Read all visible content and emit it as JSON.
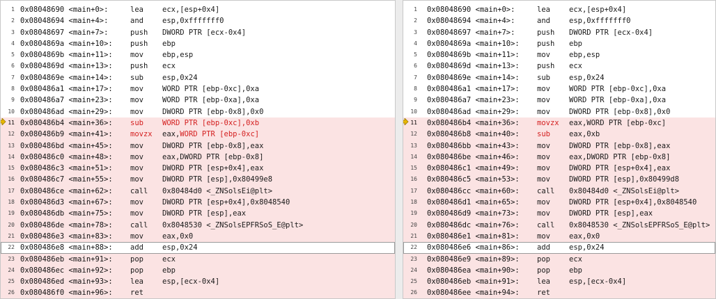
{
  "left_pane": {
    "rows": [
      {
        "n": "1",
        "addr": "0x08048690 <main+0>:",
        "op": "lea",
        "args": "ecx,[esp+0x4]",
        "changed": false
      },
      {
        "n": "2",
        "addr": "0x08048694 <main+4>:",
        "op": "and",
        "args": "esp,0xfffffff0",
        "changed": false
      },
      {
        "n": "3",
        "addr": "0x08048697 <main+7>:",
        "op": "push",
        "args": "DWORD PTR [ecx-0x4]",
        "changed": false
      },
      {
        "n": "4",
        "addr": "0x0804869a <main+10>:",
        "op": "push",
        "args": "ebp",
        "changed": false
      },
      {
        "n": "5",
        "addr": "0x0804869b <main+11>:",
        "op": "mov",
        "args": "ebp,esp",
        "changed": false
      },
      {
        "n": "6",
        "addr": "0x0804869d <main+13>:",
        "op": "push",
        "args": "ecx",
        "changed": false
      },
      {
        "n": "7",
        "addr": "0x0804869e <main+14>:",
        "op": "sub",
        "args": "esp,0x24",
        "changed": false
      },
      {
        "n": "8",
        "addr": "0x080486a1 <main+17>:",
        "op": "mov",
        "args": "WORD PTR [ebp-0xc],0xa",
        "changed": false
      },
      {
        "n": "9",
        "addr": "0x080486a7 <main+23>:",
        "op": "mov",
        "args": "WORD PTR [ebp-0xa],0xa",
        "changed": false
      },
      {
        "n": "10",
        "addr": "0x080486ad <main+29>:",
        "op": "mov",
        "args": "DWORD PTR [ebp-0x8],0x0",
        "changed": false
      },
      {
        "n": "11",
        "addr": "0x080486b4 <main+36>:",
        "op": "sub",
        "args": "WORD PTR [ebp-0xc],0xb",
        "changed": true,
        "pointer": true,
        "op_red": true,
        "args_red": true
      },
      {
        "n": "12",
        "addr": "0x080486b9 <main+41>:",
        "op": "movzx",
        "args_plain": "eax,",
        "args": "WORD PTR [ebp-0xc]",
        "changed": true,
        "op_red": true,
        "args_red": true
      },
      {
        "n": "13",
        "addr": "0x080486bd <main+45>:",
        "op": "mov",
        "args": "DWORD PTR [ebp-0x8],eax",
        "changed": true,
        "addr_red": "d"
      },
      {
        "n": "14",
        "addr": "0x080486c0 <main+48>:",
        "op": "mov",
        "args": "eax,DWORD PTR [ebp-0x8]",
        "changed": true,
        "addr_red": "0"
      },
      {
        "n": "15",
        "addr": "0x080486c3 <main+51>:",
        "op": "mov",
        "args": "DWORD PTR [esp+0x4],eax",
        "changed": true,
        "addr_red": "3"
      },
      {
        "n": "16",
        "addr": "0x080486c7 <main+55>:",
        "op": "mov",
        "args": "DWORD PTR [esp],0x80499e8",
        "changed": true,
        "addr_red": "7"
      },
      {
        "n": "17",
        "addr": "0x080486ce <main+62>:",
        "op": "call",
        "args": "0x80484d0 <_ZNSolsEi@plt>",
        "changed": true
      },
      {
        "n": "18",
        "addr": "0x080486d3 <main+67>:",
        "op": "mov",
        "args": "DWORD PTR [esp+0x4],0x8048540",
        "changed": true
      },
      {
        "n": "19",
        "addr": "0x080486db <main+75>:",
        "op": "mov",
        "args": "DWORD PTR [esp],eax",
        "changed": true
      },
      {
        "n": "20",
        "addr": "0x080486de <main+78>:",
        "op": "call",
        "args": "0x8048530 <_ZNSolsEPFRSoS_E@plt>",
        "changed": true
      },
      {
        "n": "21",
        "addr": "0x080486e3 <main+83>:",
        "op": "mov",
        "args": "eax,0x0",
        "changed": true
      },
      {
        "n": "22",
        "addr": "0x080486e8 <main+88>:",
        "op": "add",
        "args": "esp,0x24",
        "changed": false,
        "current": true,
        "addr_red": "8"
      },
      {
        "n": "23",
        "addr": "0x080486eb <main+91>:",
        "op": "pop",
        "args": "ecx",
        "changed": true
      },
      {
        "n": "24",
        "addr": "0x080486ec <main+92>:",
        "op": "pop",
        "args": "ebp",
        "changed": true
      },
      {
        "n": "25",
        "addr": "0x080486ed <main+93>:",
        "op": "lea",
        "args": "esp,[ecx-0x4]",
        "changed": true
      },
      {
        "n": "26",
        "addr": "0x080486f0 <main+96>:",
        "op": "ret",
        "args": "",
        "changed": true
      }
    ]
  },
  "right_pane": {
    "rows": [
      {
        "n": "1",
        "addr": "0x08048690 <main+0>:",
        "op": "lea",
        "args": "ecx,[esp+0x4]",
        "changed": false
      },
      {
        "n": "2",
        "addr": "0x08048694 <main+4>:",
        "op": "and",
        "args": "esp,0xfffffff0",
        "changed": false
      },
      {
        "n": "3",
        "addr": "0x08048697 <main+7>:",
        "op": "push",
        "args": "DWORD PTR [ecx-0x4]",
        "changed": false
      },
      {
        "n": "4",
        "addr": "0x0804869a <main+10>:",
        "op": "push",
        "args": "ebp",
        "changed": false
      },
      {
        "n": "5",
        "addr": "0x0804869b <main+11>:",
        "op": "mov",
        "args": "ebp,esp",
        "changed": false
      },
      {
        "n": "6",
        "addr": "0x0804869d <main+13>:",
        "op": "push",
        "args": "ecx",
        "changed": false
      },
      {
        "n": "7",
        "addr": "0x0804869e <main+14>:",
        "op": "sub",
        "args": "esp,0x24",
        "changed": false
      },
      {
        "n": "8",
        "addr": "0x080486a1 <main+17>:",
        "op": "mov",
        "args": "WORD PTR [ebp-0xc],0xa",
        "changed": false
      },
      {
        "n": "9",
        "addr": "0x080486a7 <main+23>:",
        "op": "mov",
        "args": "WORD PTR [ebp-0xa],0xa",
        "changed": false
      },
      {
        "n": "10",
        "addr": "0x080486ad <main+29>:",
        "op": "mov",
        "args": "DWORD PTR [ebp-0x8],0x0",
        "changed": false
      },
      {
        "n": "11",
        "addr": "0x080486b4 <main+36>:",
        "op": "movzx",
        "args": "eax,WORD PTR [ebp-0xc]",
        "changed": true,
        "pointer": true,
        "op_red": true
      },
      {
        "n": "12",
        "addr": "0x080486b8 <main+40>:",
        "op": "sub",
        "args": "eax,0xb",
        "changed": true,
        "op_red": true
      },
      {
        "n": "13",
        "addr": "0x080486bb <main+43>:",
        "op": "mov",
        "args": "DWORD PTR [ebp-0x8],eax",
        "changed": true,
        "addr_red": "b"
      },
      {
        "n": "14",
        "addr": "0x080486be <main+46>:",
        "op": "mov",
        "args": "eax,DWORD PTR [ebp-0x8]",
        "changed": true,
        "addr_red": "e"
      },
      {
        "n": "15",
        "addr": "0x080486c1 <main+49>:",
        "op": "mov",
        "args": "DWORD PTR [esp+0x4],eax",
        "changed": true,
        "addr_red": "1"
      },
      {
        "n": "16",
        "addr": "0x080486c5 <main+53>:",
        "op": "mov",
        "args": "DWORD PTR [esp],0x80499d8",
        "changed": true,
        "addr_red": "5"
      },
      {
        "n": "17",
        "addr": "0x080486cc <main+60>:",
        "op": "call",
        "args": "0x80484d0 <_ZNSolsEi@plt>",
        "changed": true
      },
      {
        "n": "18",
        "addr": "0x080486d1 <main+65>:",
        "op": "mov",
        "args": "DWORD PTR [esp+0x4],0x8048540",
        "changed": true
      },
      {
        "n": "19",
        "addr": "0x080486d9 <main+73>:",
        "op": "mov",
        "args": "DWORD PTR [esp],eax",
        "changed": true
      },
      {
        "n": "20",
        "addr": "0x080486dc <main+76>:",
        "op": "call",
        "args": "0x8048530 <_ZNSolsEPFRSoS_E@plt>",
        "changed": true
      },
      {
        "n": "21",
        "addr": "0x080486e1 <main+81>:",
        "op": "mov",
        "args": "eax,0x0",
        "changed": true
      },
      {
        "n": "22",
        "addr": "0x080486e6 <main+86>:",
        "op": "add",
        "args": "esp,0x24",
        "changed": false,
        "current": true,
        "addr_red": "6"
      },
      {
        "n": "23",
        "addr": "0x080486e9 <main+89>:",
        "op": "pop",
        "args": "ecx",
        "changed": true
      },
      {
        "n": "24",
        "addr": "0x080486ea <main+90>:",
        "op": "pop",
        "args": "ebp",
        "changed": true
      },
      {
        "n": "25",
        "addr": "0x080486eb <main+91>:",
        "op": "lea",
        "args": "esp,[ecx-0x4]",
        "changed": true
      },
      {
        "n": "26",
        "addr": "0x080486ee <main+94>:",
        "op": "ret",
        "args": "",
        "changed": true
      }
    ]
  },
  "colors": {
    "changed_bg": "#fbe3e3",
    "highlight_text": "#d42020",
    "pointer": "#e8b800"
  },
  "icons": {
    "pointer": "arrow-pointer-icon"
  }
}
